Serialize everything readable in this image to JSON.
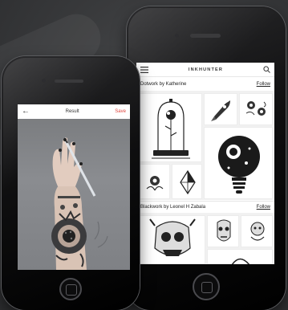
{
  "front_app": {
    "back_icon": "arrow-left-icon",
    "title": "Result",
    "save_label": "Save"
  },
  "back_app": {
    "menu_icon": "hamburger-menu-icon",
    "brand": "INKHUNTER",
    "search_icon": "search-icon",
    "sections": [
      {
        "title": "Dotwork by Katherine",
        "follow_label": "Follow"
      },
      {
        "title": "Blackwork by Leonel H Zabala",
        "follow_label": "Follow"
      }
    ]
  },
  "colors": {
    "accent": "#e0463f",
    "background": "#3b3c3e"
  }
}
